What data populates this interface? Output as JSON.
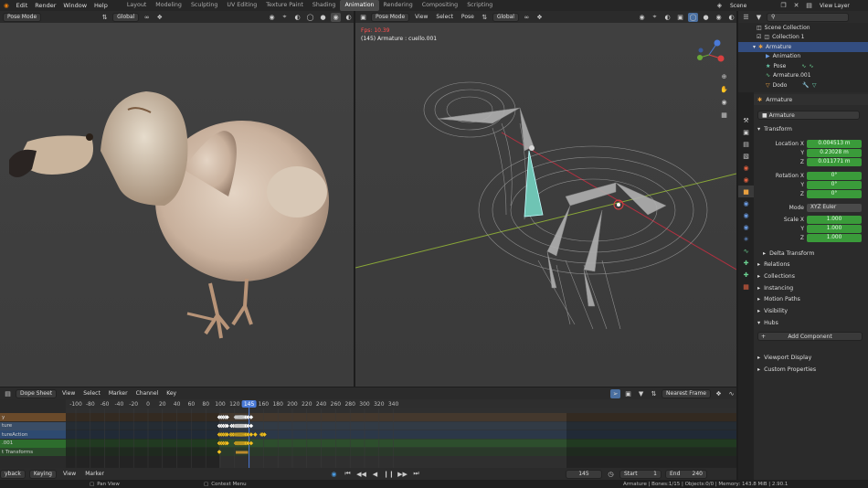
{
  "topbar": {
    "menus": [
      "Edit",
      "Render",
      "Window",
      "Help"
    ],
    "workspaces": [
      "Layout",
      "Modeling",
      "Sculpting",
      "UV Editing",
      "Texture Paint",
      "Shading",
      "Animation",
      "Rendering",
      "Compositing",
      "Scripting"
    ],
    "active_workspace": "Animation",
    "scene": "Scene",
    "view_layer": "View Layer"
  },
  "viewport_left": {
    "mode": "Pose Mode",
    "orientation": "Global"
  },
  "viewport_right": {
    "mode": "Pose Mode",
    "menus": [
      "View",
      "Select",
      "Pose"
    ],
    "orientation": "Global",
    "info_line1": "Fps: 10.39",
    "info_line2": "(145) Armature : cuello.001"
  },
  "outliner": {
    "items": [
      {
        "label": "Scene Collection",
        "indent": 0
      },
      {
        "label": "Collection 1",
        "indent": 1
      },
      {
        "label": "Armature",
        "indent": 2
      },
      {
        "label": "Animation",
        "indent": 3
      },
      {
        "label": "Pose",
        "indent": 3
      },
      {
        "label": "Armature.001",
        "indent": 3
      },
      {
        "label": "Dodo",
        "indent": 3
      }
    ]
  },
  "properties": {
    "object": "Armature",
    "data_name": "Armature",
    "transform_title": "Transform",
    "location": {
      "label": "Location X",
      "x": "0.004513 m",
      "y": "0.23028 m",
      "z": "0.011771 m"
    },
    "rotation": {
      "label": "Rotation X",
      "x": "0°",
      "y": "0°",
      "z": "0°"
    },
    "mode_label": "Mode",
    "mode_value": "XYZ Euler",
    "scale": {
      "label": "Scale X",
      "x": "1.000",
      "y": "1.000",
      "z": "1.000"
    },
    "axis_y": "Y",
    "axis_z": "Z",
    "sections": [
      "Delta Transform",
      "Relations",
      "Collections",
      "Instancing",
      "Motion Paths",
      "Visibility",
      "Hubs"
    ],
    "add_component": "Add Component",
    "sections2": [
      "Viewport Display",
      "Custom Properties"
    ]
  },
  "dopesheet": {
    "editor": "Dope Sheet",
    "menus": [
      "View",
      "Select",
      "Marker",
      "Channel",
      "Key"
    ],
    "snap": "Nearest Frame",
    "ticks": [
      "-100",
      "-80",
      "-60",
      "-40",
      "-20",
      "0",
      "20",
      "40",
      "60",
      "80",
      "100",
      "120",
      "145",
      "160",
      "180",
      "200",
      "220",
      "240",
      "260",
      "280",
      "300",
      "320",
      "340"
    ],
    "current_frame": "145",
    "channels": [
      {
        "label": "y",
        "color": "#6a4a2a"
      },
      {
        "label": "ture",
        "color": "#3a4d66"
      },
      {
        "label": "tureAction",
        "color": "#2e4a70"
      },
      {
        "label": ".001",
        "color": "#2d6d2d"
      },
      {
        "label": "t Transforms",
        "color": "#2a4a2a"
      }
    ]
  },
  "framebar": {
    "menus": [
      "yback",
      "Keying",
      "View",
      "Marker"
    ],
    "frame": "145",
    "start_label": "Start",
    "start": "1",
    "end_label": "End",
    "end": "240"
  },
  "status": {
    "left": "Pan View",
    "mid": "Context Menu",
    "right": "Armature | Bones:1/15 | Objects:0/0 | Memory: 143.8 MiB | 2.90.1"
  }
}
